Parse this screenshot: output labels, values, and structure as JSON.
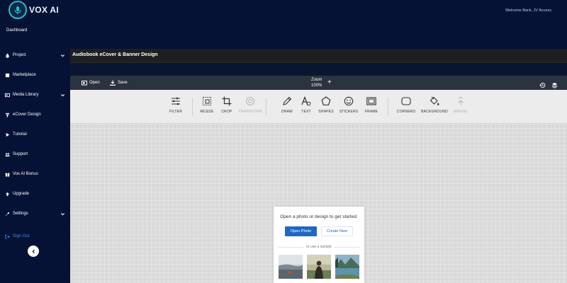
{
  "app": {
    "logo_text": "VOX AI"
  },
  "header": {
    "welcome": "Welcome Back, JV Access"
  },
  "sidebar": {
    "dashboard": "Dashboard",
    "items": [
      {
        "label": "Project",
        "icon": "drop-icon",
        "has_chevron": true
      },
      {
        "label": "Marketplace",
        "icon": "store-icon",
        "has_chevron": false
      },
      {
        "label": "Media Library",
        "icon": "media-icon",
        "has_chevron": true
      },
      {
        "label": "eCover Design",
        "icon": "ecover-icon",
        "has_chevron": false
      },
      {
        "label": "Tutorial",
        "icon": "play-icon",
        "has_chevron": false
      },
      {
        "label": "Support",
        "icon": "users-icon",
        "has_chevron": false
      },
      {
        "label": "Vox AI Bonus",
        "icon": "gift-icon",
        "has_chevron": false
      },
      {
        "label": "Upgrade",
        "icon": "arrow-up-icon",
        "has_chevron": false
      },
      {
        "label": "Settings",
        "icon": "wrench-icon",
        "has_chevron": true
      }
    ],
    "signout": "Sign Out"
  },
  "page": {
    "title": "Audiobook eCover & Banner Design"
  },
  "editor": {
    "open_label": "Open",
    "save_label": "Save",
    "zoom_label": "Zoom",
    "zoom_value": "100%"
  },
  "tools": [
    {
      "label": "FILTER",
      "icon": "sliders-icon",
      "disabled": false
    },
    {
      "label": "RESIZE",
      "icon": "resize-icon",
      "disabled": false
    },
    {
      "label": "CROP",
      "icon": "crop-icon",
      "disabled": false
    },
    {
      "label": "TRANSFORM",
      "icon": "transform-icon",
      "disabled": true
    },
    {
      "label": "DRAW",
      "icon": "pencil-icon",
      "disabled": false
    },
    {
      "label": "TEXT",
      "icon": "text-icon",
      "disabled": false
    },
    {
      "label": "SHAPES",
      "icon": "pentagon-icon",
      "disabled": false
    },
    {
      "label": "STICKERS",
      "icon": "smiley-icon",
      "disabled": false
    },
    {
      "label": "FRAME",
      "icon": "frame-icon",
      "disabled": false
    },
    {
      "label": "CORNERS",
      "icon": "corners-icon",
      "disabled": false
    },
    {
      "label": "BACKGROUND",
      "icon": "paint-bucket-icon",
      "disabled": false
    },
    {
      "label": "MERGE",
      "icon": "merge-icon",
      "disabled": true
    }
  ],
  "start": {
    "prompt": "Open a photo or design to get started.",
    "open_photo": "Open Photo",
    "create_new": "Create New",
    "sample_label": "or use a sample"
  },
  "colors": {
    "sidebar_bg": "#061235",
    "accent_blue": "#1f67c4",
    "signout": "#3d8bf2",
    "canvas_bg": "#d9d9d9"
  }
}
